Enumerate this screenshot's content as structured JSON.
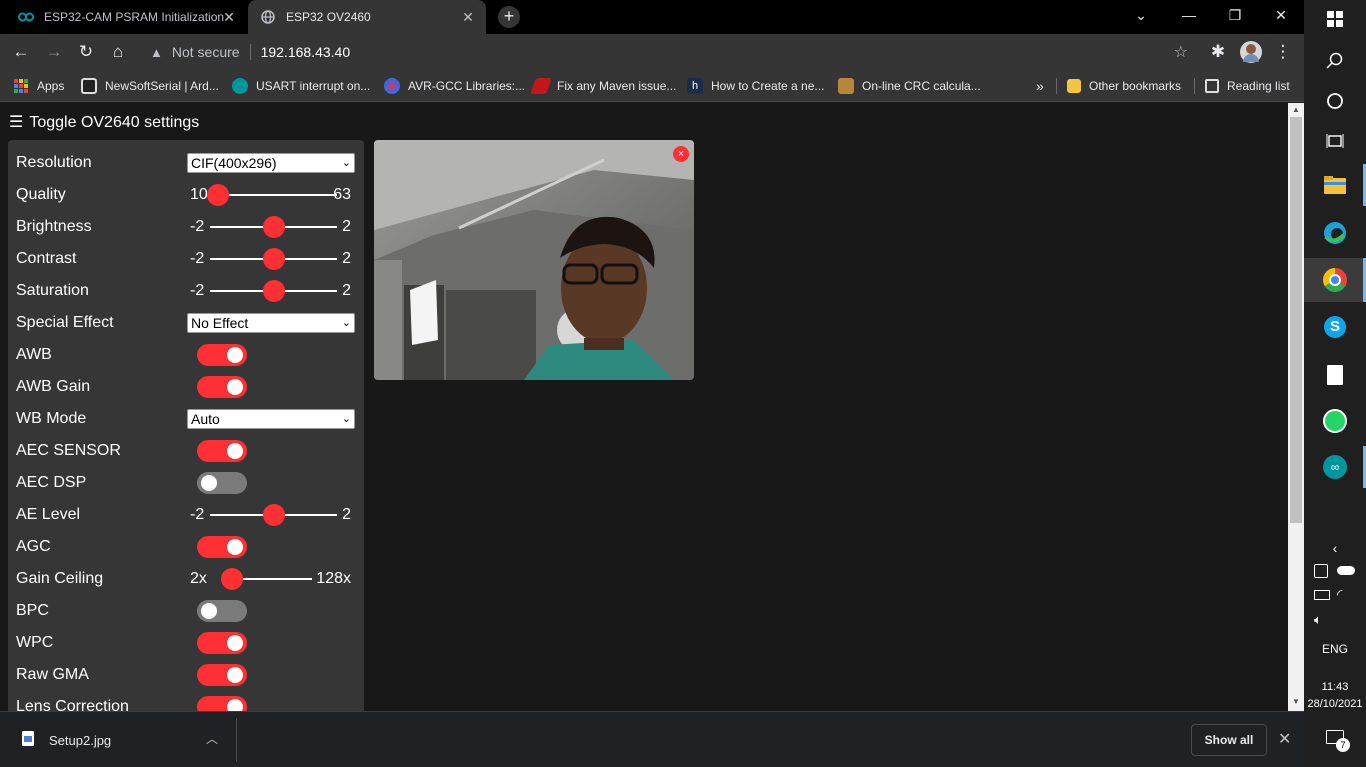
{
  "tabs": [
    {
      "title": "ESP32-CAM PSRAM Initialization",
      "icon": "arduino-icon"
    },
    {
      "title": "ESP32 OV2460",
      "icon": "globe-icon"
    }
  ],
  "omnibox": {
    "security_label": "Not secure",
    "url": "192.168.43.40"
  },
  "bookmarks": [
    {
      "label": "Apps",
      "icon": "apps-grid-icon"
    },
    {
      "label": "NewSoftSerial | Ard...",
      "icon": "page-icon"
    },
    {
      "label": "USART interrupt on...",
      "icon": "arduino-icon"
    },
    {
      "label": "AVR-GCC Libraries:...",
      "icon": "sphere-icon"
    },
    {
      "label": "Fix any Maven issue...",
      "icon": "maven-icon"
    },
    {
      "label": "How to Create a ne...",
      "icon": "h-icon"
    },
    {
      "label": "On-line CRC calcula...",
      "icon": "avatar-icon"
    }
  ],
  "bookmarks_overflow": "»",
  "other_bookmarks": "Other bookmarks",
  "reading_list": "Reading list",
  "page": {
    "toggle_label": "Toggle OV2640 settings",
    "controls": [
      {
        "label": "Resolution",
        "type": "select",
        "value": "CIF(400x296)"
      },
      {
        "label": "Quality",
        "type": "range",
        "min": "10",
        "max": "63",
        "level": 0.0
      },
      {
        "label": "Brightness",
        "type": "range",
        "min": "-2",
        "max": "2",
        "level": 0.5
      },
      {
        "label": "Contrast",
        "type": "range",
        "min": "-2",
        "max": "2",
        "level": 0.5
      },
      {
        "label": "Saturation",
        "type": "range",
        "min": "-2",
        "max": "2",
        "level": 0.5
      },
      {
        "label": "Special Effect",
        "type": "select",
        "value": "No Effect"
      },
      {
        "label": "AWB",
        "type": "switch",
        "on": true
      },
      {
        "label": "AWB Gain",
        "type": "switch",
        "on": true
      },
      {
        "label": "WB Mode",
        "type": "select",
        "value": "Auto"
      },
      {
        "label": "AEC SENSOR",
        "type": "switch",
        "on": true
      },
      {
        "label": "AEC DSP",
        "type": "switch",
        "on": false
      },
      {
        "label": "AE Level",
        "type": "range",
        "min": "-2",
        "max": "2",
        "level": 0.5
      },
      {
        "label": "AGC",
        "type": "switch",
        "on": true
      },
      {
        "label": "Gain Ceiling",
        "type": "range",
        "min": "2x",
        "max": "128x",
        "level": 0.0
      },
      {
        "label": "BPC",
        "type": "switch",
        "on": false
      },
      {
        "label": "WPC",
        "type": "switch",
        "on": true
      },
      {
        "label": "Raw GMA",
        "type": "switch",
        "on": true
      },
      {
        "label": "Lens Correction",
        "type": "switch",
        "on": true
      }
    ],
    "stream_close": "×"
  },
  "downloads": {
    "file": "Setup2.jpg",
    "show_all": "Show all"
  },
  "taskbar": {
    "language": "ENG",
    "time": "11:43",
    "date": "28/10/2021",
    "notifications": "7"
  },
  "colors": {
    "accent": "#ff3034",
    "panel": "#363636",
    "page_bg": "#181818"
  }
}
